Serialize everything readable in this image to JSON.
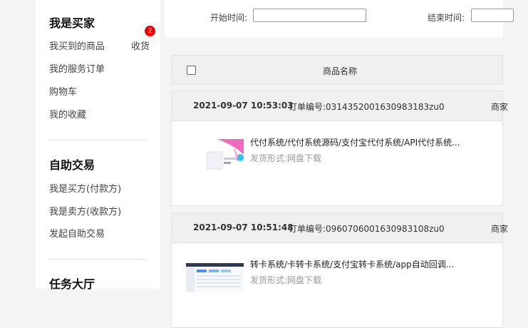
{
  "sidebar": {
    "sections": [
      {
        "title": "我是买家",
        "items": [
          "我买到的商品",
          "我的服务订单",
          "购物车",
          "我的收藏"
        ]
      },
      {
        "title": "自助交易",
        "items": [
          "我是买方(付款方)",
          "我是卖方(收款方)",
          "发起自助交易"
        ]
      },
      {
        "title": "任务大厅"
      }
    ],
    "receive_label": "收货",
    "receive_badge": "2"
  },
  "filters": {
    "start_label": "开始时间:",
    "start_value": "",
    "end_label": "结束时间:",
    "end_value": ""
  },
  "list_header": {
    "product_name": "商品名称"
  },
  "orders": [
    {
      "datetime": "2021-09-07 10:53:03",
      "order_no_label": "订单编号:",
      "order_no": "0314352001630983183zu0",
      "shop_label": "商家",
      "title": "代付系统/代付系统源码/支付宝代付系统/API代付系统...",
      "ship_label": "发货形式:",
      "ship_value": "网盘下载"
    },
    {
      "datetime": "2021-09-07 10:51:48",
      "order_no_label": "订单编号:",
      "order_no": "0960706001630983108zu0",
      "shop_label": "商家",
      "title": "转卡系统/卡转卡系统/支付宝转卡系统/app自动回调...",
      "ship_label": "发货形式:",
      "ship_value": "网盘下载"
    }
  ]
}
